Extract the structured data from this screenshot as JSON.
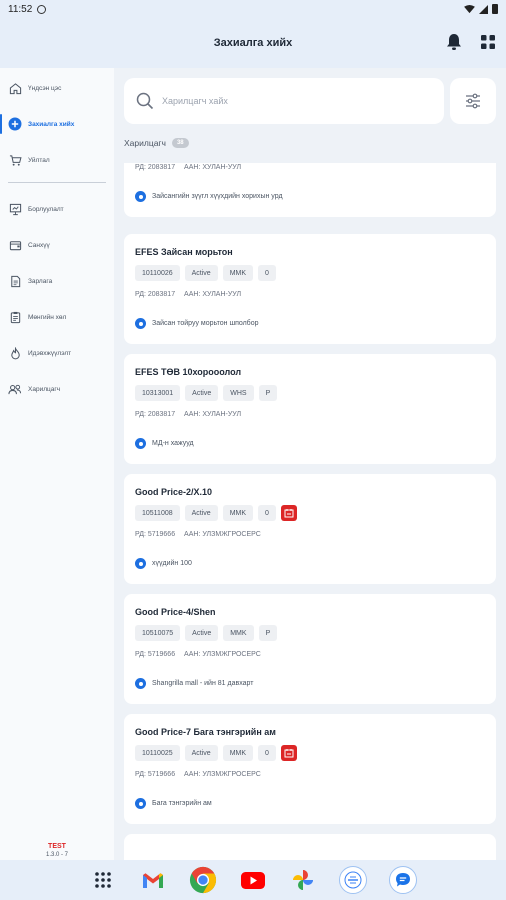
{
  "status_bar": {
    "time": "11:52"
  },
  "app_bar": {
    "title": "Захиалга хийх"
  },
  "sidebar": {
    "items": [
      {
        "label": "Үндсэн цэс",
        "icon": "home-icon",
        "active": false
      },
      {
        "label": "Захиалга хийх",
        "icon": "plus-circle-icon",
        "active": true
      },
      {
        "label": "Уйлтал",
        "icon": "cart-icon",
        "active": false
      },
      {
        "label": "Борлуулалт",
        "icon": "presentation-icon",
        "active": false
      },
      {
        "label": "Санхүү",
        "icon": "wallet-icon",
        "active": false
      },
      {
        "label": "Зарлага",
        "icon": "document-icon",
        "active": false
      },
      {
        "label": "Мөнгийн хөл",
        "icon": "clipboard-icon",
        "active": false
      },
      {
        "label": "Идэвхжүүлэлт",
        "icon": "flame-icon",
        "active": false
      },
      {
        "label": "Харилцагч",
        "icon": "users-icon",
        "active": false
      }
    ],
    "footer": {
      "env": "TEST",
      "version": "1.3.0 - 7"
    }
  },
  "search": {
    "placeholder": "Харилцагч хайх"
  },
  "section": {
    "label": "Харилцагч",
    "count": "38"
  },
  "cards": [
    {
      "name": "",
      "chips": [],
      "meta": {
        "rd": "РД: 2083817",
        "aan": "ААН: ХУЛАН-УУЛ"
      },
      "address": "Зайсангийн зүүгл хүүхдийн хорихын урд"
    },
    {
      "name": "EFES Зайсан морьтон",
      "chips": [
        "10110026",
        "Active",
        "MMK",
        "0"
      ],
      "alert": false,
      "meta": {
        "rd": "РД: 2083817",
        "aan": "ААН: ХУЛАН-УУЛ"
      },
      "address": "Зайсан тойруу морьтон шполбор"
    },
    {
      "name": "EFES ТӨВ 10хорооолол",
      "chips": [
        "10313001",
        "Active",
        "WHS",
        "P"
      ],
      "alert": false,
      "meta": {
        "rd": "РД: 2083817",
        "aan": "ААН: ХУЛАН-УУЛ"
      },
      "address": "МД-н хажууд"
    },
    {
      "name": "Good Price-2/Х.10",
      "chips": [
        "10511008",
        "Active",
        "MMK",
        "0"
      ],
      "alert": true,
      "meta": {
        "rd": "РД: 5719666",
        "aan": "ААН: УЛЗМЖГРОСЕРС"
      },
      "address": "хүүдийн 100"
    },
    {
      "name": "Good Price-4/Shen",
      "chips": [
        "10510075",
        "Active",
        "MMK",
        "P"
      ],
      "alert": false,
      "meta": {
        "rd": "РД: 5719666",
        "aan": "ААН: УЛЗМЖГРОСЕРС"
      },
      "address": "Shangrilla mall - ийн 81 давхарт"
    },
    {
      "name": "Good Price-7 Бага тэнгэрийн ам",
      "chips": [
        "10110025",
        "Active",
        "MMK",
        "0"
      ],
      "alert": true,
      "meta": {
        "rd": "РД: 5719666",
        "aan": "ААН: УЛЗМЖГРОСЕРС"
      },
      "address": "Бага тэнгэрийн ам"
    }
  ],
  "dock": [
    "apps-grid-icon",
    "gmail-icon",
    "chrome-icon",
    "youtube-icon",
    "photos-icon",
    "app-icon",
    "messages-icon"
  ],
  "colors": {
    "accent": "#1d6fe0",
    "alert": "#dc2626",
    "bar_bg": "#e6eef9",
    "page_bg": "#eef2f7"
  }
}
